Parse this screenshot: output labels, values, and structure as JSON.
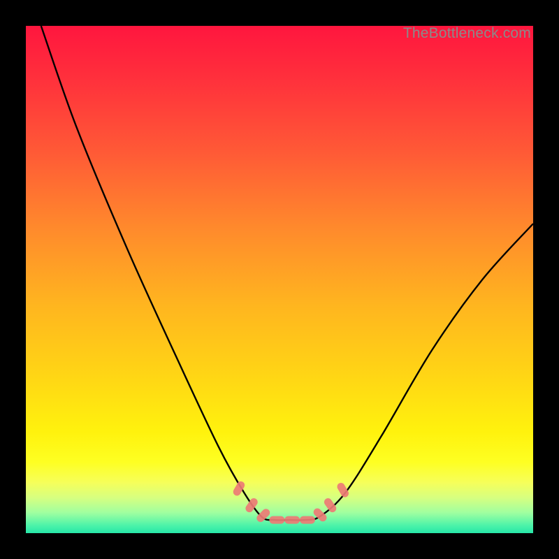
{
  "watermark": "TheBottleneck.com",
  "chart_data": {
    "type": "line",
    "title": "",
    "xlabel": "",
    "ylabel": "",
    "xlim": [
      0,
      100
    ],
    "ylim": [
      0,
      100
    ],
    "grid": false,
    "legend": false,
    "background_gradient": {
      "orientation": "vertical",
      "stops": [
        {
          "pos": 0,
          "color": "#ff163e"
        },
        {
          "pos": 50,
          "color": "#ffb300"
        },
        {
          "pos": 85,
          "color": "#feff22"
        },
        {
          "pos": 100,
          "color": "#26e6a8"
        }
      ]
    },
    "series": [
      {
        "name": "bottleneck-curve",
        "color": "#000000",
        "x": [
          3,
          10,
          20,
          30,
          38,
          43,
          46.5,
          49,
          52,
          55,
          58,
          63,
          70,
          80,
          90,
          100
        ],
        "y": [
          100,
          80,
          56,
          34,
          17,
          8,
          3.2,
          2.6,
          2.6,
          2.6,
          3.3,
          8,
          19,
          36,
          50,
          61
        ]
      }
    ],
    "markers": {
      "name": "bottom-markers",
      "color": "#ed7b75",
      "shape": "capsule",
      "points": [
        {
          "x": 42.0,
          "y": 8.8,
          "angle": -60
        },
        {
          "x": 44.5,
          "y": 5.5,
          "angle": -55
        },
        {
          "x": 46.8,
          "y": 3.5,
          "angle": -45
        },
        {
          "x": 49.5,
          "y": 2.6,
          "angle": 0
        },
        {
          "x": 52.5,
          "y": 2.6,
          "angle": 0
        },
        {
          "x": 55.5,
          "y": 2.6,
          "angle": 0
        },
        {
          "x": 58.0,
          "y": 3.6,
          "angle": 45
        },
        {
          "x": 60.0,
          "y": 5.5,
          "angle": 55
        },
        {
          "x": 62.5,
          "y": 8.5,
          "angle": 60
        }
      ]
    }
  }
}
